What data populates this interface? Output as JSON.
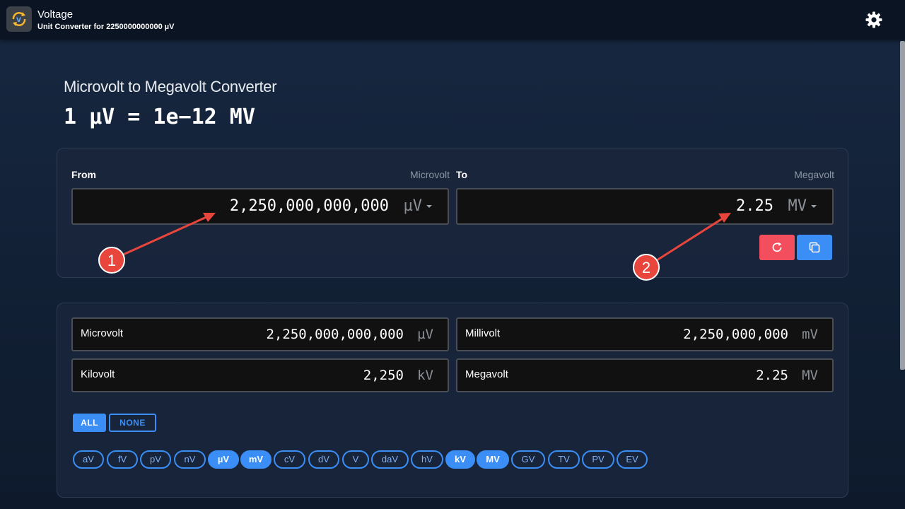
{
  "app": {
    "title": "Voltage",
    "subtitle": "Unit Converter for 2250000000000 µV",
    "icon": "voltage-convert-icon",
    "settings_icon": "gear-icon"
  },
  "header": {
    "title": "Microvolt to Megavolt Converter",
    "formula": "1 µV = 1e−12 MV"
  },
  "converter": {
    "from_label": "From",
    "from_unit_name": "Microvolt",
    "from_value": "2,250,000,000,000",
    "from_unit": "µV",
    "to_label": "To",
    "to_unit_name": "Megavolt",
    "to_value": "2.25",
    "to_unit": "MV",
    "reset_icon": "refresh-icon",
    "copy_icon": "copy-icon"
  },
  "results": [
    {
      "name": "Microvolt",
      "value": "2,250,000,000,000",
      "unit": "µV"
    },
    {
      "name": "Millivolt",
      "value": "2,250,000,000",
      "unit": "mV"
    },
    {
      "name": "Kilovolt",
      "value": "2,250",
      "unit": "kV"
    },
    {
      "name": "Megavolt",
      "value": "2.25",
      "unit": "MV"
    }
  ],
  "toggles": {
    "all": "ALL",
    "none": "NONE"
  },
  "chips": [
    {
      "label": "aV",
      "on": false
    },
    {
      "label": "fV",
      "on": false
    },
    {
      "label": "pV",
      "on": false
    },
    {
      "label": "nV",
      "on": false
    },
    {
      "label": "µV",
      "on": true
    },
    {
      "label": "mV",
      "on": true
    },
    {
      "label": "cV",
      "on": false
    },
    {
      "label": "dV",
      "on": false
    },
    {
      "label": "V",
      "on": false
    },
    {
      "label": "daV",
      "on": false
    },
    {
      "label": "hV",
      "on": false
    },
    {
      "label": "kV",
      "on": true
    },
    {
      "label": "MV",
      "on": true
    },
    {
      "label": "GV",
      "on": false
    },
    {
      "label": "TV",
      "on": false
    },
    {
      "label": "PV",
      "on": false
    },
    {
      "label": "EV",
      "on": false
    }
  ],
  "annotations": {
    "marker_1": "1",
    "marker_2": "2",
    "color": "#e8453c"
  },
  "colors": {
    "accent": "#3a8ef6",
    "danger": "#f24e5e"
  }
}
